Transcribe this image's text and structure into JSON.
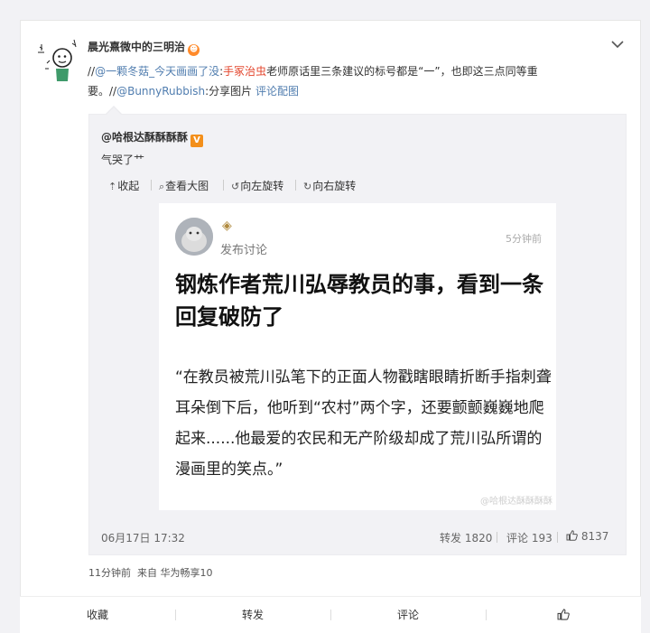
{
  "post": {
    "author": "晨光熹微中的三明治",
    "author_badge": "☻",
    "text_prefix": "//",
    "mention1": "@一颗冬菇_今天画画了没",
    "text_colon1": ":",
    "highlight": "手冢治虫",
    "text_body": "老师原话里三条建议的标号都是“一”，也即这三点同等重要。//",
    "mention2": "@BunnyRubbish",
    "text_colon2": ":分享图片",
    "link_comment_pic": "评论配图"
  },
  "retweet": {
    "author": "@哈根达酥酥酥酥",
    "verified_badge": "V",
    "text": "气哭了艹",
    "tools": [
      {
        "icon": "⇡",
        "label": "收起"
      },
      {
        "icon": "⌕",
        "label": "查看大图"
      },
      {
        "icon": "↺",
        "label": "向左旋转"
      },
      {
        "icon": "↻",
        "label": "向右旋转"
      }
    ],
    "image": {
      "sub_label": "发布讨论",
      "time": "5分钟前",
      "title": "钢炼作者荒川弘辱教员的事，看到一条回复破防了",
      "body": "“在教员被荒川弘笔下的正面人物戳瞎眼睛折断手指刺聋耳朵倒下后，他听到“农村”两个字，还要颤颤巍巍地爬起来......他最爱的农民和无产阶级却成了荒川弘所谓的漫画里的笑点。”",
      "watermark": "@哈根达酥酥酥酥"
    },
    "date": "06月17日 17:32",
    "repost": "转发 1820",
    "comment": "评论 193",
    "like_count": "8137"
  },
  "meta": {
    "time": "11分钟前",
    "source": "来自 华为畅享10"
  },
  "actions": {
    "favorite": "收藏",
    "repost": "转发",
    "comment": "评论"
  },
  "colors": {
    "link": "#507daf",
    "highlight": "#e3452c",
    "quote_bg": "#f2f2f5"
  }
}
